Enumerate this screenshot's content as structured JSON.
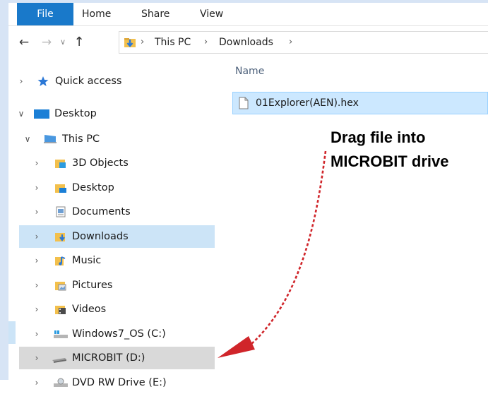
{
  "ribbon": {
    "tabs": [
      {
        "label": "File",
        "active": true
      },
      {
        "label": "Home"
      },
      {
        "label": "Share"
      },
      {
        "label": "View"
      }
    ]
  },
  "address": {
    "breadcrumbs": [
      "This PC",
      "Downloads"
    ]
  },
  "nav": {
    "items": [
      {
        "label": "Quick access",
        "icon": "star-icon"
      },
      {
        "label": "Desktop",
        "icon": "desktop-icon"
      },
      {
        "label": "This PC",
        "icon": "computer-icon"
      },
      {
        "label": "3D Objects",
        "icon": "cube-folder-icon"
      },
      {
        "label": "Desktop",
        "icon": "desktop-folder-icon"
      },
      {
        "label": "Documents",
        "icon": "documents-icon"
      },
      {
        "label": "Downloads",
        "icon": "downloads-icon",
        "selected": true
      },
      {
        "label": "Music",
        "icon": "music-icon"
      },
      {
        "label": "Pictures",
        "icon": "pictures-icon"
      },
      {
        "label": "Videos",
        "icon": "videos-icon"
      },
      {
        "label": "Windows7_OS (C:)",
        "icon": "windows-drive-icon"
      },
      {
        "label": "MICROBIT (D:)",
        "icon": "usb-drive-icon",
        "hover": true
      },
      {
        "label": "DVD RW Drive (E:)",
        "icon": "dvd-drive-icon"
      }
    ]
  },
  "files": {
    "column_header": "Name",
    "items": [
      {
        "name": "01Explorer(AEN).hex",
        "icon": "file-icon"
      }
    ]
  },
  "annotation": {
    "line1": "Drag file into",
    "line2": "MICROBIT drive",
    "arrow_color": "#d0252a"
  },
  "colors": {
    "accent": "#1979ca",
    "selection": "#cce4f7",
    "file_selection": "#cce8ff"
  }
}
